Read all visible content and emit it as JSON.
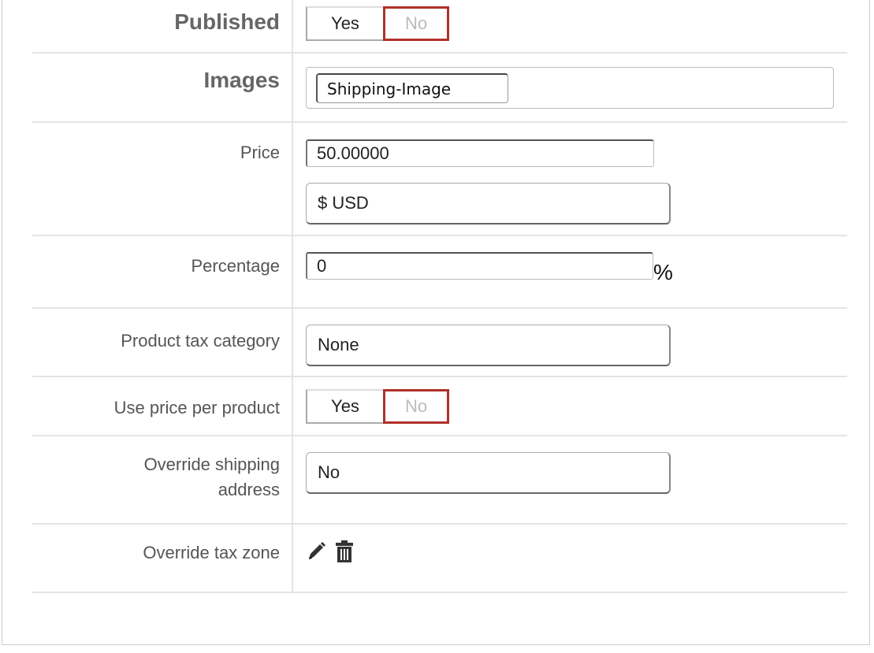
{
  "form": {
    "published": {
      "label": "Published",
      "yes": "Yes",
      "no": "No",
      "selected": "No"
    },
    "images": {
      "label": "Images",
      "chip": "Shipping-Image"
    },
    "price": {
      "label": "Price",
      "value": "50.00000",
      "currency": "$ USD"
    },
    "percentage": {
      "label": "Percentage",
      "value": "0",
      "unit": "%"
    },
    "tax_category": {
      "label": "Product tax category",
      "value": "None"
    },
    "price_per_product": {
      "label": "Use price per product",
      "yes": "Yes",
      "no": "No",
      "selected": "No"
    },
    "override_shipping": {
      "label_line1": "Override shipping",
      "label_line2": "address",
      "value": "No"
    },
    "override_tax_zone": {
      "label": "Override tax zone",
      "icons": [
        "pencil-icon",
        "trash-icon"
      ]
    }
  },
  "colors": {
    "accent_red": "#b0302a",
    "divider": "#e4e4e4"
  }
}
